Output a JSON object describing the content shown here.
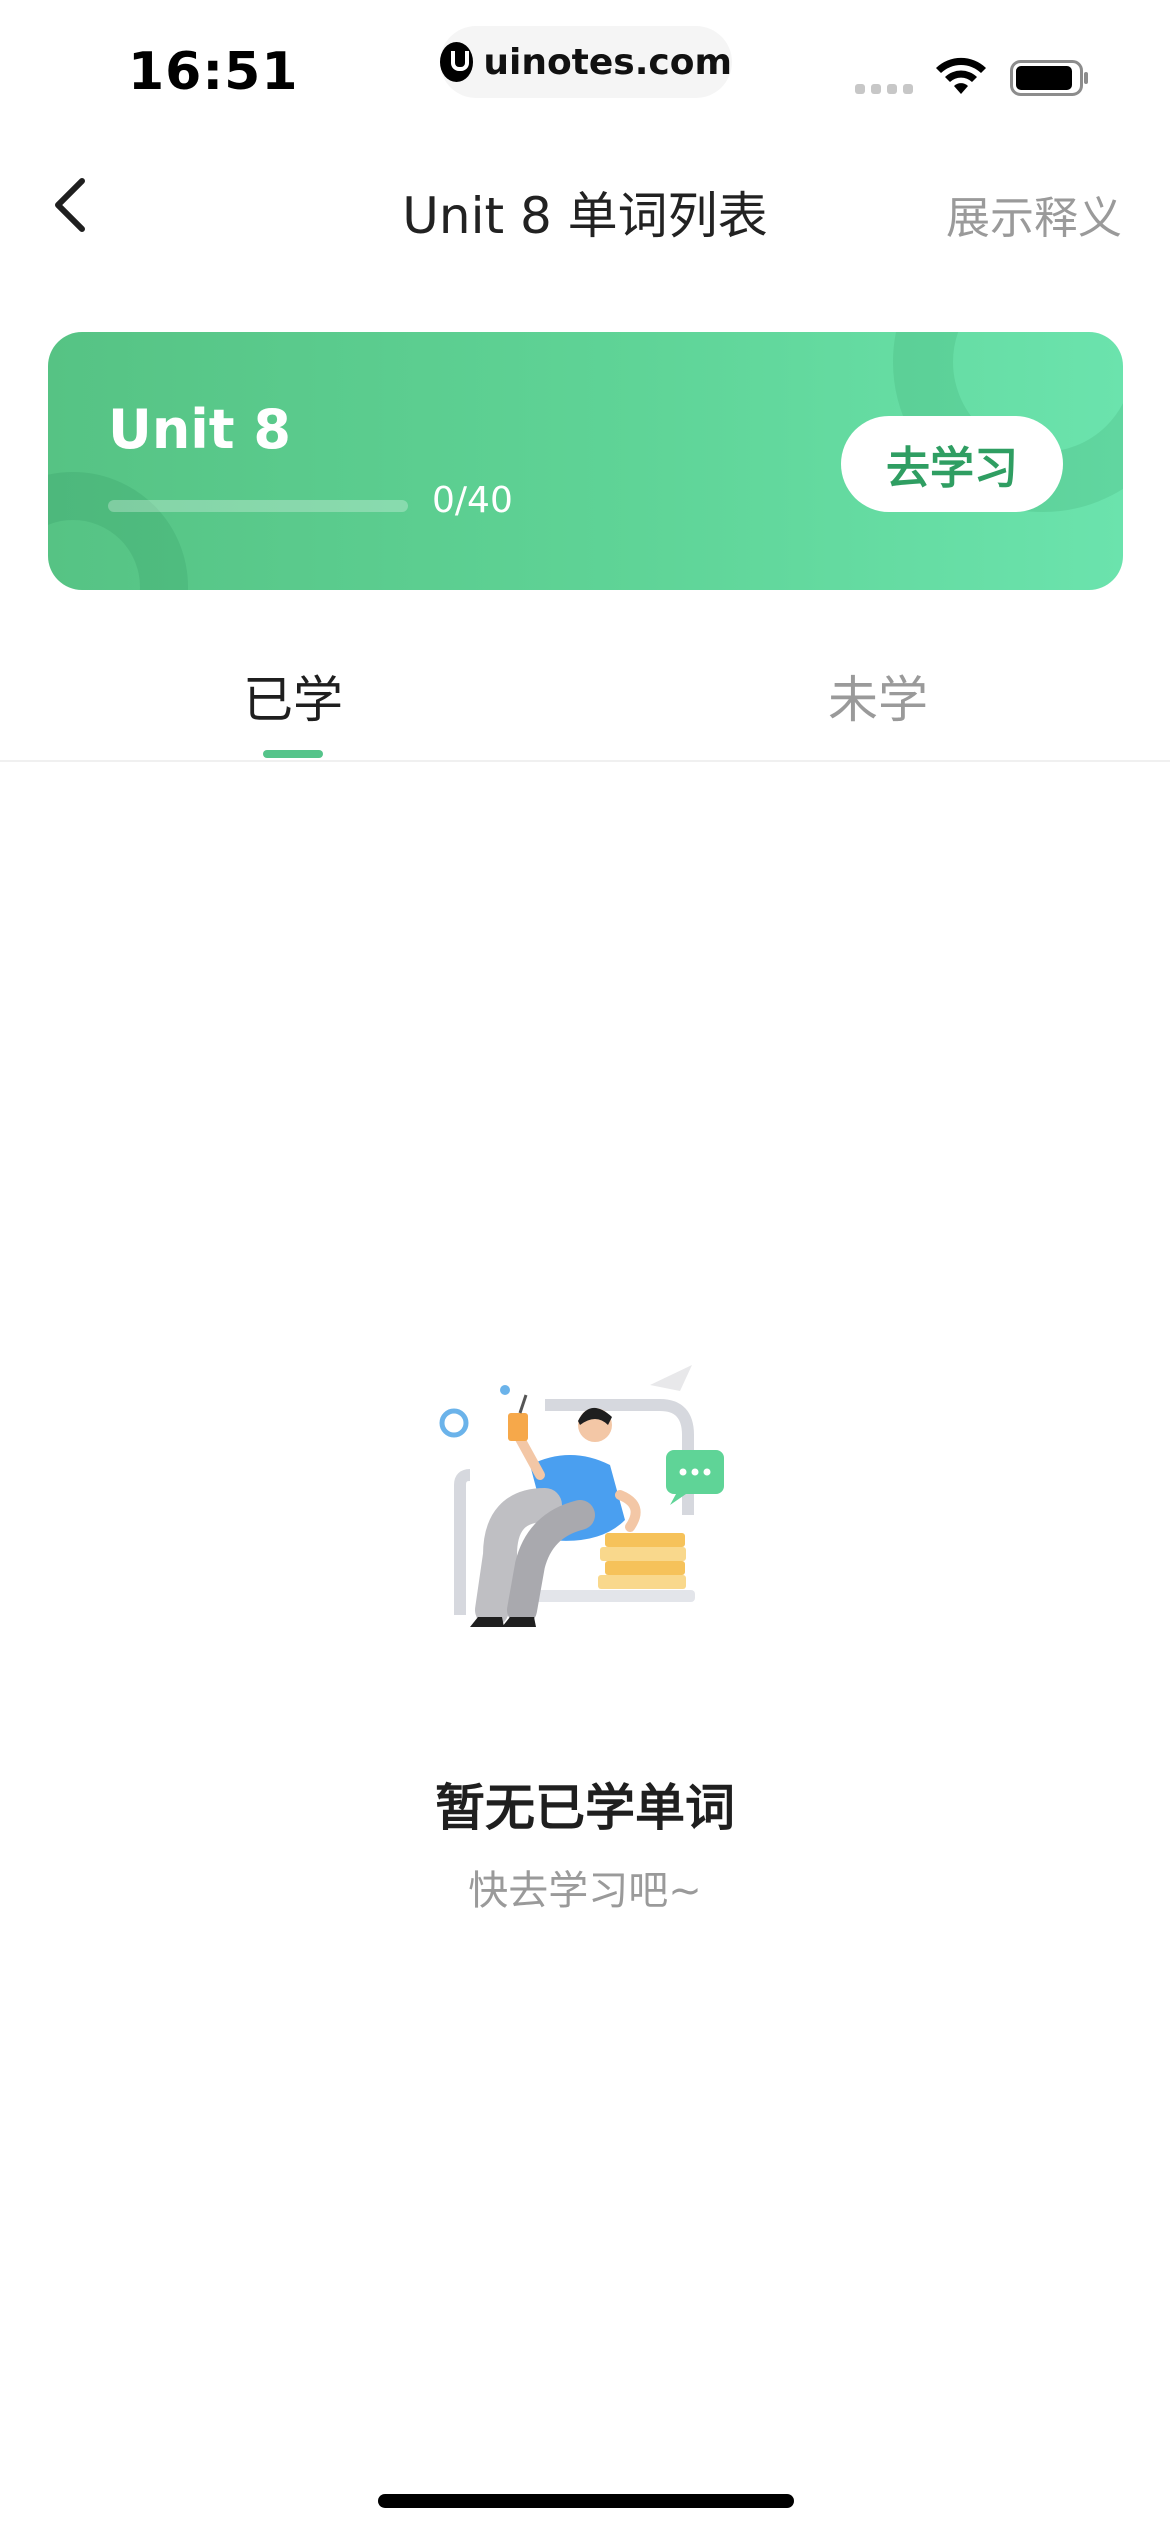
{
  "status_bar": {
    "time": "16:51",
    "url": "uinotes.com"
  },
  "nav": {
    "title": "Unit 8 单词列表",
    "action": "展示释义",
    "back_icon": "chevron-left-icon"
  },
  "card": {
    "title": "Unit 8",
    "progress_text": "0/40",
    "progress_fraction": 0,
    "button_label": "去学习",
    "gradient_start": "#56c384",
    "gradient_end": "#6be3ad",
    "button_text_color": "#2f9e62"
  },
  "tabs": [
    {
      "label": "已学",
      "active": true
    },
    {
      "label": "未学",
      "active": false
    }
  ],
  "empty_state": {
    "title": "暂无已学单词",
    "subtitle": "快去学习吧~",
    "illustration": "person-reading-illustration"
  },
  "colors": {
    "accent": "#55c48a",
    "text_primary": "#1f1f1f",
    "text_secondary": "#9a9a9a"
  }
}
